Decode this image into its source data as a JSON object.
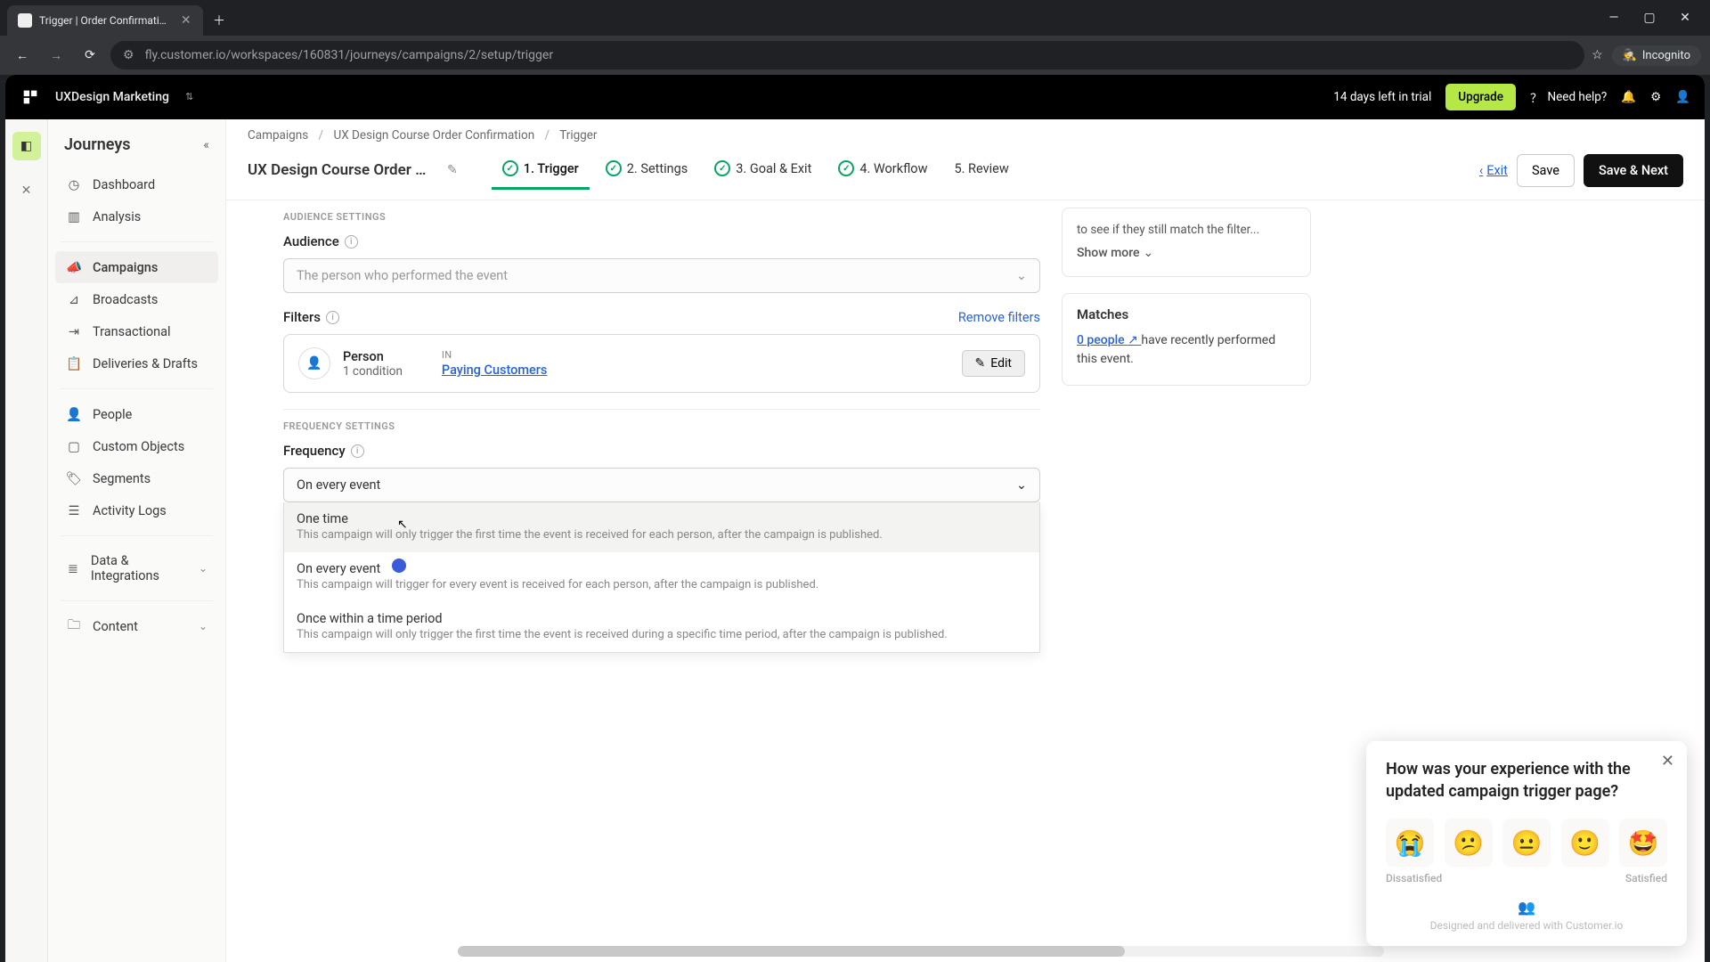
{
  "browser": {
    "tab_title": "Trigger | Order Confirmation | C",
    "url": "fly.customer.io/workspaces/160831/journeys/campaigns/2/setup/trigger",
    "incognito": "Incognito"
  },
  "topbar": {
    "workspace": "UXDesign Marketing",
    "trial": "14 days left in trial",
    "upgrade": "Upgrade",
    "help": "Need help?"
  },
  "sidebar": {
    "title": "Journeys",
    "items": [
      {
        "label": "Dashboard",
        "icon": "gauge"
      },
      {
        "label": "Analysis",
        "icon": "chart"
      },
      {
        "label": "Campaigns",
        "icon": "megaphone",
        "active": true
      },
      {
        "label": "Broadcasts",
        "icon": "broadcast"
      },
      {
        "label": "Transactional",
        "icon": "arrow-right-box"
      },
      {
        "label": "Deliveries & Drafts",
        "icon": "clipboard"
      },
      {
        "label": "People",
        "icon": "user"
      },
      {
        "label": "Custom Objects",
        "icon": "box"
      },
      {
        "label": "Segments",
        "icon": "tag"
      },
      {
        "label": "Activity Logs",
        "icon": "list"
      },
      {
        "label": "Data & Integrations",
        "icon": "database",
        "chevron": true
      },
      {
        "label": "Content",
        "icon": "folder",
        "chevron": true
      }
    ]
  },
  "breadcrumb": {
    "a": "Campaigns",
    "b": "UX Design Course Order Confirmation",
    "c": "Trigger"
  },
  "header": {
    "title": "UX Design Course Order Confi...",
    "steps": [
      {
        "num": "1.",
        "label": "Trigger",
        "done": true,
        "active": true
      },
      {
        "num": "2.",
        "label": "Settings",
        "done": true
      },
      {
        "num": "3.",
        "label": "Goal & Exit",
        "done": true
      },
      {
        "num": "4.",
        "label": "Workflow",
        "done": true
      },
      {
        "num": "5.",
        "label": "Review",
        "done": false
      }
    ],
    "exit": "Exit",
    "save": "Save",
    "save_next": "Save & Next"
  },
  "form": {
    "audience_section": "AUDIENCE SETTINGS",
    "audience_label": "Audience",
    "audience_placeholder": "The person who performed the event",
    "filters_label": "Filters",
    "remove_filters": "Remove filters",
    "filter_person": "Person",
    "filter_condition": "1 condition",
    "filter_in": "IN",
    "filter_segment": "Paying Customers",
    "edit": "Edit",
    "freq_section": "FREQUENCY SETTINGS",
    "freq_label": "Frequency",
    "freq_value": "On every event",
    "freq_options": [
      {
        "title": "One time",
        "desc": "This campaign will only trigger the first time the event is received for each person, after the campaign is published."
      },
      {
        "title": "On every event",
        "desc": "This campaign will trigger for every event is received for each person, after the campaign is published."
      },
      {
        "title": "Once within a time period",
        "desc": "This campaign will only trigger the first time the event is received during a specific time period, after the campaign is published."
      }
    ]
  },
  "side": {
    "help_text": "to see if they still match the filter...",
    "show_more": "Show more",
    "matches": "Matches",
    "match_count": "0 people",
    "match_suffix": " have recently performed this event."
  },
  "survey": {
    "question": "How was your experience with the updated campaign trigger page?",
    "low": "Dissatisfied",
    "high": "Satisfied",
    "footer": "Designed and delivered with Customer.io",
    "emojis": [
      "😭",
      "😕",
      "😐",
      "🙂",
      "🤩"
    ]
  }
}
